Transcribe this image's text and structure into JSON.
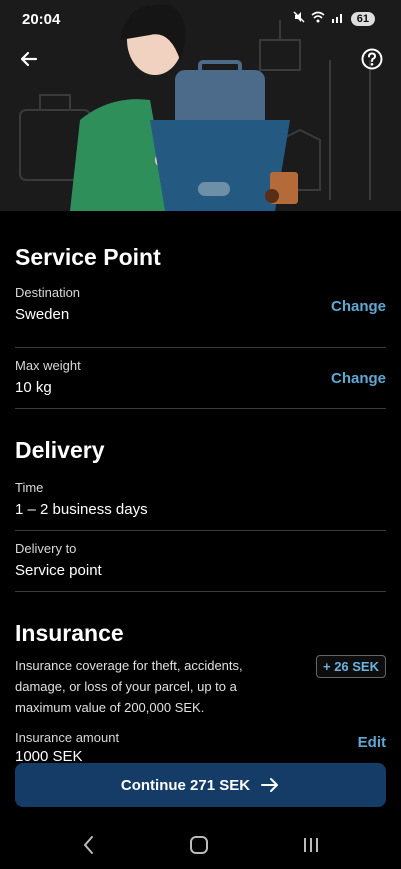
{
  "status": {
    "time": "20:04",
    "battery": "61"
  },
  "service_point": {
    "title": "Service Point",
    "destination_label": "Destination",
    "destination_value": "Sweden",
    "destination_action": "Change",
    "weight_label": "Max weight",
    "weight_value": "10 kg",
    "weight_action": "Change"
  },
  "delivery": {
    "title": "Delivery",
    "time_label": "Time",
    "time_value": "1 – 2 business days",
    "to_label": "Delivery to",
    "to_value": "Service point"
  },
  "insurance": {
    "title": "Insurance",
    "description": "Insurance coverage for theft, accidents, damage, or loss of your parcel, up to a maximum value of 200,000 SEK.",
    "badge": "+ 26 SEK",
    "amount_label": "Insurance amount",
    "amount_value": "1000 SEK",
    "amount_action": "Edit"
  },
  "continue_button": {
    "label": "Continue 271 SEK"
  },
  "colors": {
    "accent": "#5fa8d3",
    "button": "#143c66",
    "background": "#000000"
  }
}
